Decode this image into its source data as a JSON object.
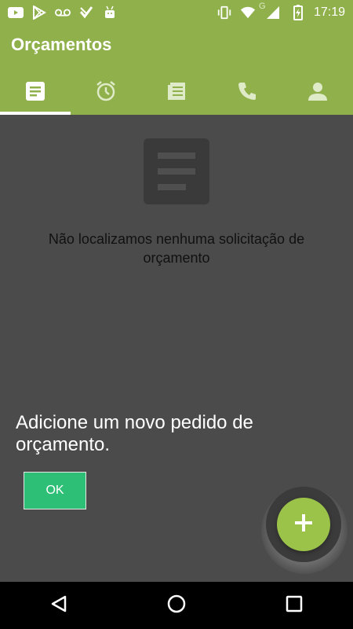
{
  "status_bar": {
    "time": "17:19",
    "left_icons": [
      "youtube-icon",
      "play-store-icon",
      "voicemail-icon",
      "check-app-icon",
      "android-icon"
    ],
    "right_icons": [
      "vibrate-icon",
      "wifi-icon",
      "signal-icon",
      "battery-charging-icon"
    ],
    "network_letter": "G"
  },
  "app_bar": {
    "title": "Orçamentos",
    "tabs": [
      {
        "icon": "document-icon",
        "active": true
      },
      {
        "icon": "alarm-icon",
        "active": false
      },
      {
        "icon": "notes-icon",
        "active": false
      },
      {
        "icon": "phone-icon",
        "active": false
      },
      {
        "icon": "person-icon",
        "active": false
      }
    ]
  },
  "content": {
    "empty_icon": "document-empty-icon",
    "empty_message": "Não localizamos nenhuma solicitação de orçamento"
  },
  "tip": {
    "text": "Adicione um novo pedido de orçamento.",
    "ok_label": "OK"
  },
  "fab": {
    "icon": "plus-icon",
    "color": "#9bc34a"
  },
  "colors": {
    "primary": "#8fb04a",
    "overlay": "#4b4b4b",
    "ok_button": "#2ebf77"
  },
  "navigation_bar": {
    "buttons": [
      "back-icon",
      "home-icon",
      "recents-icon"
    ]
  }
}
